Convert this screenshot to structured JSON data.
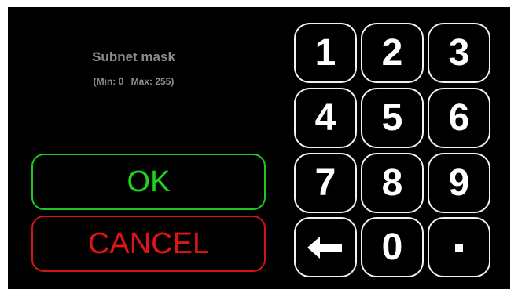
{
  "prompt": {
    "title": "Subnet mask",
    "min_text": "(Min: 0",
    "max_text": "Max: 255)"
  },
  "actions": {
    "ok_label": "OK",
    "cancel_label": "CANCEL"
  },
  "keypad": {
    "k1": "1",
    "k2": "2",
    "k3": "3",
    "k4": "4",
    "k5": "5",
    "k6": "6",
    "k7": "7",
    "k8": "8",
    "k9": "9",
    "k0": "0",
    "backspace_icon": "left-arrow-icon",
    "dot_icon": "decimal-point-icon"
  },
  "colors": {
    "ok": "#1ed21e",
    "cancel": "#e01414",
    "key_border": "#f2f2f2",
    "label": "#8c8c8c"
  }
}
